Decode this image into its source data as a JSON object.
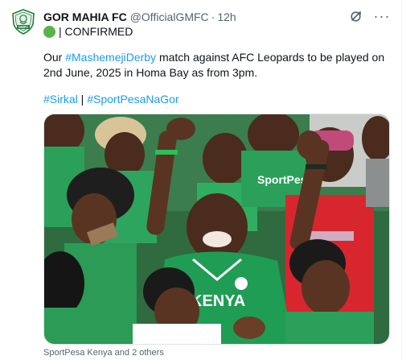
{
  "account": {
    "display_name": "GOR MAHIA FC",
    "handle": "@OfficialGMFC",
    "separator": "·",
    "time": "12h",
    "avatar_icon": "gor-mahia-crest-icon",
    "avatar_text": "GMFC"
  },
  "status": {
    "icon": "green-circle-emoji-icon",
    "text": "| CONFIRMED"
  },
  "body": {
    "prefix": "Our ",
    "hashtag": "#MashemejiDerby",
    "suffix": " match against AFC Leopards to be played on 2nd June, 2025 in Homa Bay as from 3pm."
  },
  "hashtags": {
    "first": "#Sirkal",
    "separator": " | ",
    "second": "#SportPesaNaGor"
  },
  "media": {
    "description_icon": "fans-celebrating-photo",
    "shirt_text_main": "KENYA",
    "shirt_text_sponsor": "SportPesa",
    "colors": {
      "jersey_green": "#1f9d55",
      "jersey_light": "#ffffff",
      "accent_red": "#d8262f"
    }
  },
  "tagged_text": "SportPesa Kenya and 2 others",
  "theme": {
    "link_color": "#1d9bf0",
    "secondary_text": "#536471",
    "primary_text": "#0f1419"
  }
}
